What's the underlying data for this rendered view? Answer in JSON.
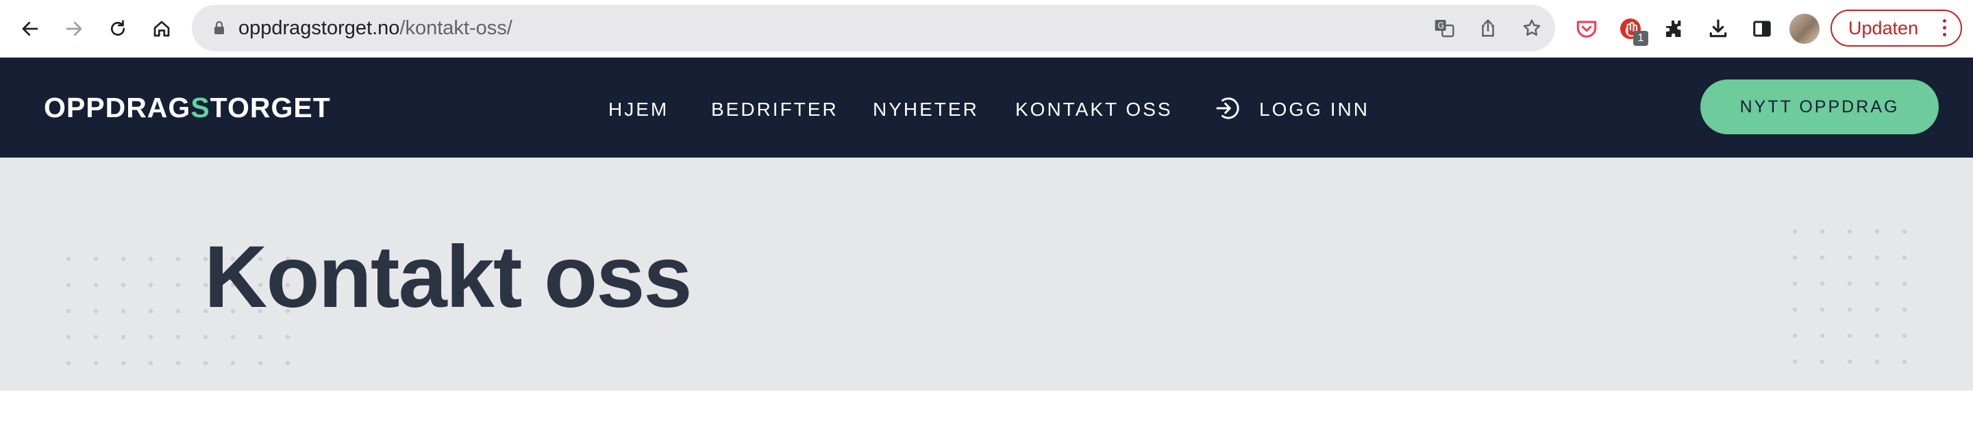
{
  "browser": {
    "url_host": "oppdragstorget.no",
    "url_path": "/kontakt-oss/",
    "extension_badge": "1",
    "update_label": "Updaten",
    "icons": [
      "back-icon",
      "forward-icon",
      "reload-icon",
      "home-icon",
      "lock-icon",
      "translate-icon",
      "share-icon",
      "star-icon",
      "pocket-icon",
      "extension-icon",
      "puzzle-icon",
      "download-icon",
      "side-panel-icon",
      "menu-dots-icon"
    ]
  },
  "header": {
    "logo_text_1": "OPPDRAG",
    "logo_accent": "S",
    "logo_text_2": "TORGET",
    "nav": [
      "HJEM",
      "BEDRIFTER",
      "NYHETER",
      "KONTAKT OSS"
    ],
    "login_label": "LOGG INN",
    "cta_label": "NYTT OPPDRAG"
  },
  "hero": {
    "title": "Kontakt oss"
  },
  "colors": {
    "header_bg": "#161f33",
    "accent_green": "#6dcb9c",
    "hero_bg": "#e6e7e9",
    "title_color": "#2c3343",
    "update_red": "#c5221f"
  }
}
